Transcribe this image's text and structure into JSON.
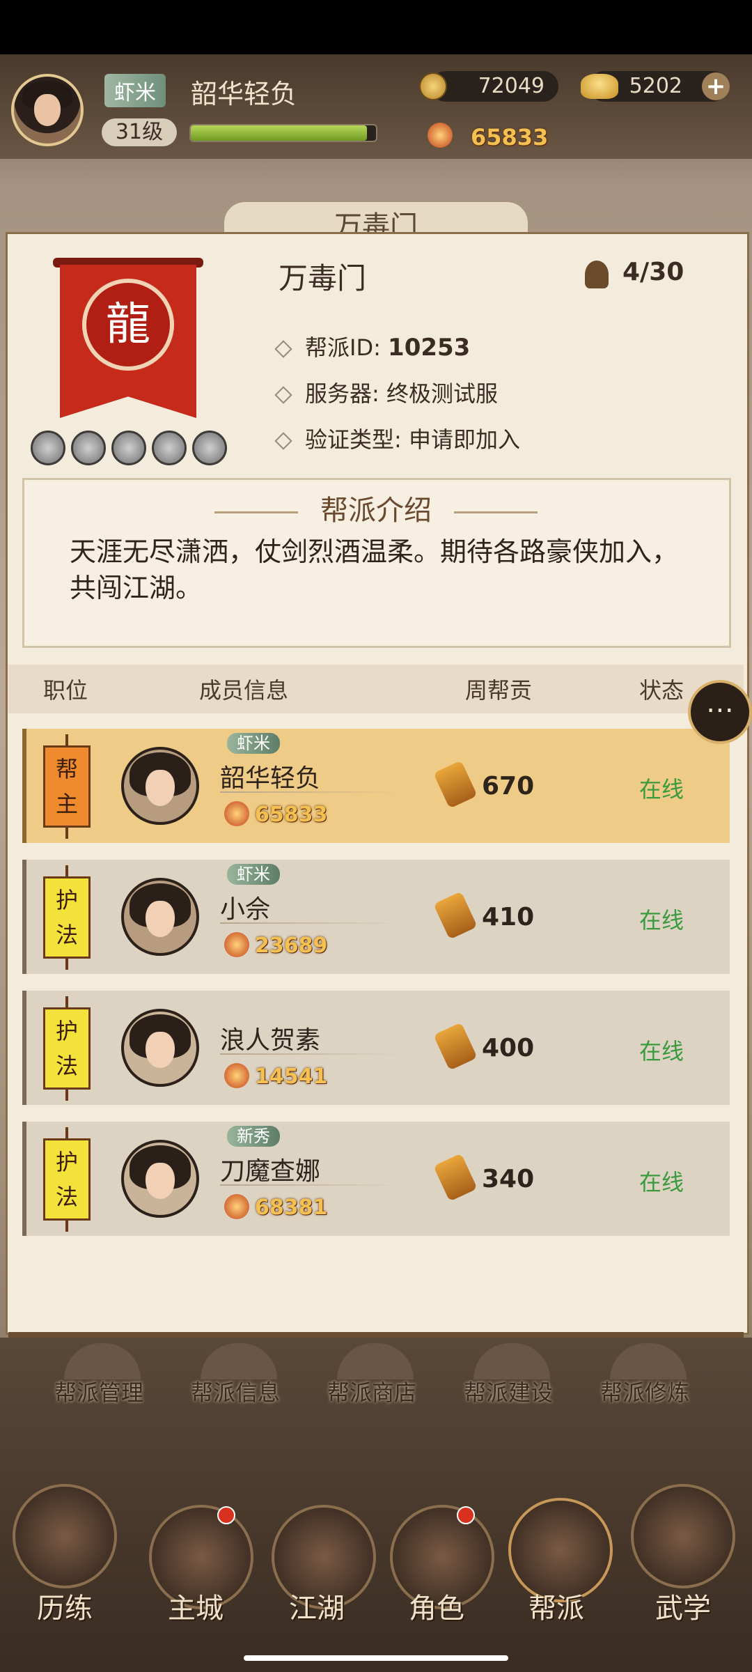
{
  "header": {
    "player_rank_tag": "虾米",
    "player_name": "韶华轻负",
    "level": "31级",
    "level_progress": 0.95,
    "coins": "72049",
    "gold": "5202",
    "power": "65833"
  },
  "tab_title": "万毒门",
  "guild": {
    "name": "万毒门",
    "member_count": "4/30",
    "id_label": "帮派ID:",
    "id_value": "10253",
    "server_label": "服务器:",
    "server_value": "终极测试服",
    "verify_label": "验证类型:",
    "verify_value": "申请即加入",
    "banner_glyph": "龍",
    "intro_title": "帮派介绍",
    "intro_text": "天涯无尽潇洒，仗剑烈酒温柔。期待各路豪侠加入，共闯江湖。"
  },
  "table": {
    "headers": [
      "职位",
      "成员信息",
      "周帮贡",
      "状态"
    ],
    "rows": [
      {
        "role": "帮主",
        "tag": "虾米",
        "name": "韶华轻负",
        "power": "65833",
        "contribution": "670",
        "status": "在线"
      },
      {
        "role": "护法",
        "tag": "虾米",
        "name": "小佘",
        "power": "23689",
        "contribution": "410",
        "status": "在线"
      },
      {
        "role": "护法",
        "tag": "",
        "name": "浪人贺素",
        "power": "14541",
        "contribution": "400",
        "status": "在线"
      },
      {
        "role": "护法",
        "tag": "新秀",
        "name": "刀魔查娜",
        "power": "68381",
        "contribution": "340",
        "status": "在线"
      }
    ]
  },
  "functions": [
    "帮派管理",
    "帮派信息",
    "帮派商店",
    "帮派建设",
    "帮派修炼"
  ],
  "nav": [
    "历练",
    "主城",
    "江湖",
    "角色",
    "帮派",
    "武学"
  ],
  "icons": {
    "coin": "coin-icon",
    "gold": "gold-ingot-icon",
    "plus": "plus-icon",
    "power": "flame-icon",
    "members": "member-icon",
    "chat": "chat-bubble-icon",
    "contribution": "token-icon"
  },
  "colors": {
    "online": "#3a9a3e",
    "leader_row": "#eecb86",
    "banner": "#c62a1b",
    "power_text": "#f4c052"
  }
}
